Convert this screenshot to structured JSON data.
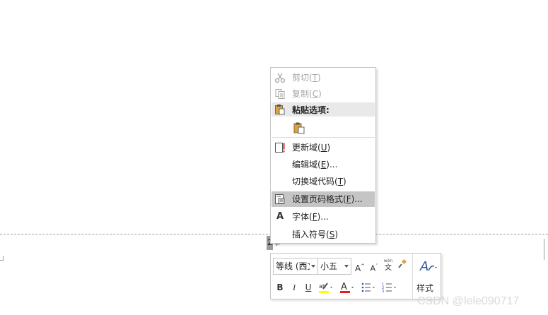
{
  "context_menu": {
    "items": [
      {
        "label": "剪切(",
        "key": "T",
        "tail": ")",
        "icon": "scissors-icon",
        "disabled": true
      },
      {
        "label": "复制(",
        "key": "C",
        "tail": ")",
        "icon": "copy-icon",
        "disabled": true
      },
      {
        "label": "粘贴选项:",
        "icon": "paste-icon",
        "header": true
      },
      {
        "label": "更新域(",
        "key": "U",
        "tail": ")",
        "icon": "update-field-icon"
      },
      {
        "label": "编辑域(",
        "key": "E",
        "tail": ")...",
        "icon": ""
      },
      {
        "label": "切换域代码(",
        "key": "T",
        "tail": ")",
        "icon": ""
      },
      {
        "label": "设置页码格式(",
        "key": "F",
        "tail": ")...",
        "icon": "page-number-format-icon",
        "highlighted": true
      },
      {
        "label": "字体(",
        "key": "F",
        "tail": ")...",
        "icon": "font-icon"
      },
      {
        "label": "插入符号(",
        "key": "S",
        "tail": ")",
        "icon": ""
      }
    ]
  },
  "mini_toolbar": {
    "font_name": "等线 (西文",
    "font_size": "小五",
    "grow_font": "A",
    "shrink_font": "A",
    "phonetic": "文",
    "bold": "B",
    "italic": "I",
    "underline": "U",
    "font_color": "A",
    "styles_label": "样式"
  },
  "page": {
    "page_number": "2",
    "colors": {
      "highlight": "#c5c5c5",
      "font_color_bar": "#e21f1f",
      "highlight_bar": "#ffff00",
      "styles_icon": "#2b579a"
    }
  },
  "watermark": "CSDN @lele090717"
}
